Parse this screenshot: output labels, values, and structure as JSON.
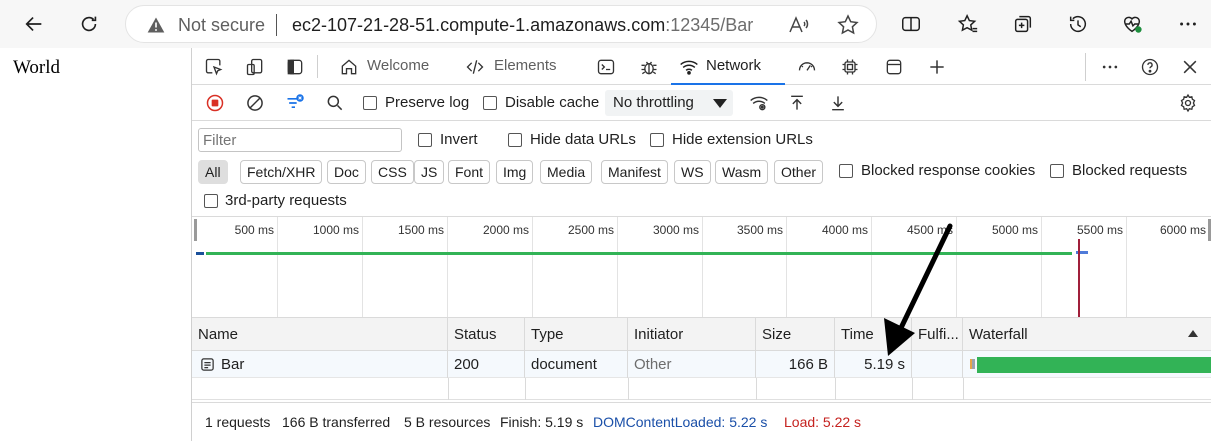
{
  "browser": {
    "not_secure": "Not secure",
    "url_host": "ec2-107-21-28-51.compute-1.amazonaws.com",
    "url_rest": ":12345/Bar"
  },
  "page": {
    "text": "World"
  },
  "devtools": {
    "tabs": {
      "welcome": "Welcome",
      "elements": "Elements",
      "network": "Network"
    },
    "toolbar": {
      "preserve_log": "Preserve log",
      "disable_cache": "Disable cache",
      "throttling": "No throttling"
    },
    "filter": {
      "placeholder": "Filter",
      "invert": "Invert",
      "hide_data_urls": "Hide data URLs",
      "hide_extension_urls": "Hide extension URLs",
      "types": [
        "All",
        "Fetch/XHR",
        "Doc",
        "CSS",
        "JS",
        "Font",
        "Img",
        "Media",
        "Manifest",
        "WS",
        "Wasm",
        "Other"
      ],
      "blocked_response_cookies": "Blocked response cookies",
      "blocked_requests": "Blocked requests",
      "third_party": "3rd-party requests"
    },
    "overview": {
      "ticks": [
        "500 ms",
        "1000 ms",
        "1500 ms",
        "2000 ms",
        "2500 ms",
        "3000 ms",
        "3500 ms",
        "4000 ms",
        "4500 ms",
        "5000 ms",
        "5500 ms",
        "6000 ms"
      ]
    },
    "table": {
      "headers": [
        "Name",
        "Status",
        "Type",
        "Initiator",
        "Size",
        "Time",
        "Fulfi...",
        "Waterfall"
      ],
      "rows": [
        {
          "name": "Bar",
          "status": "200",
          "type": "document",
          "initiator": "Other",
          "size": "166 B",
          "time": "5.19 s"
        }
      ]
    },
    "status": {
      "requests": "1 requests",
      "transferred": "166 B transferred",
      "resources": "5 B resources",
      "finish": "Finish: 5.19 s",
      "dcl": "DOMContentLoaded: 5.22 s",
      "load": "Load: 5.22 s"
    }
  },
  "colors": {
    "accent": "#1a73e8",
    "waterfall": "#32b356",
    "dcl": "#1a4fa8",
    "load": "#c5221f"
  }
}
